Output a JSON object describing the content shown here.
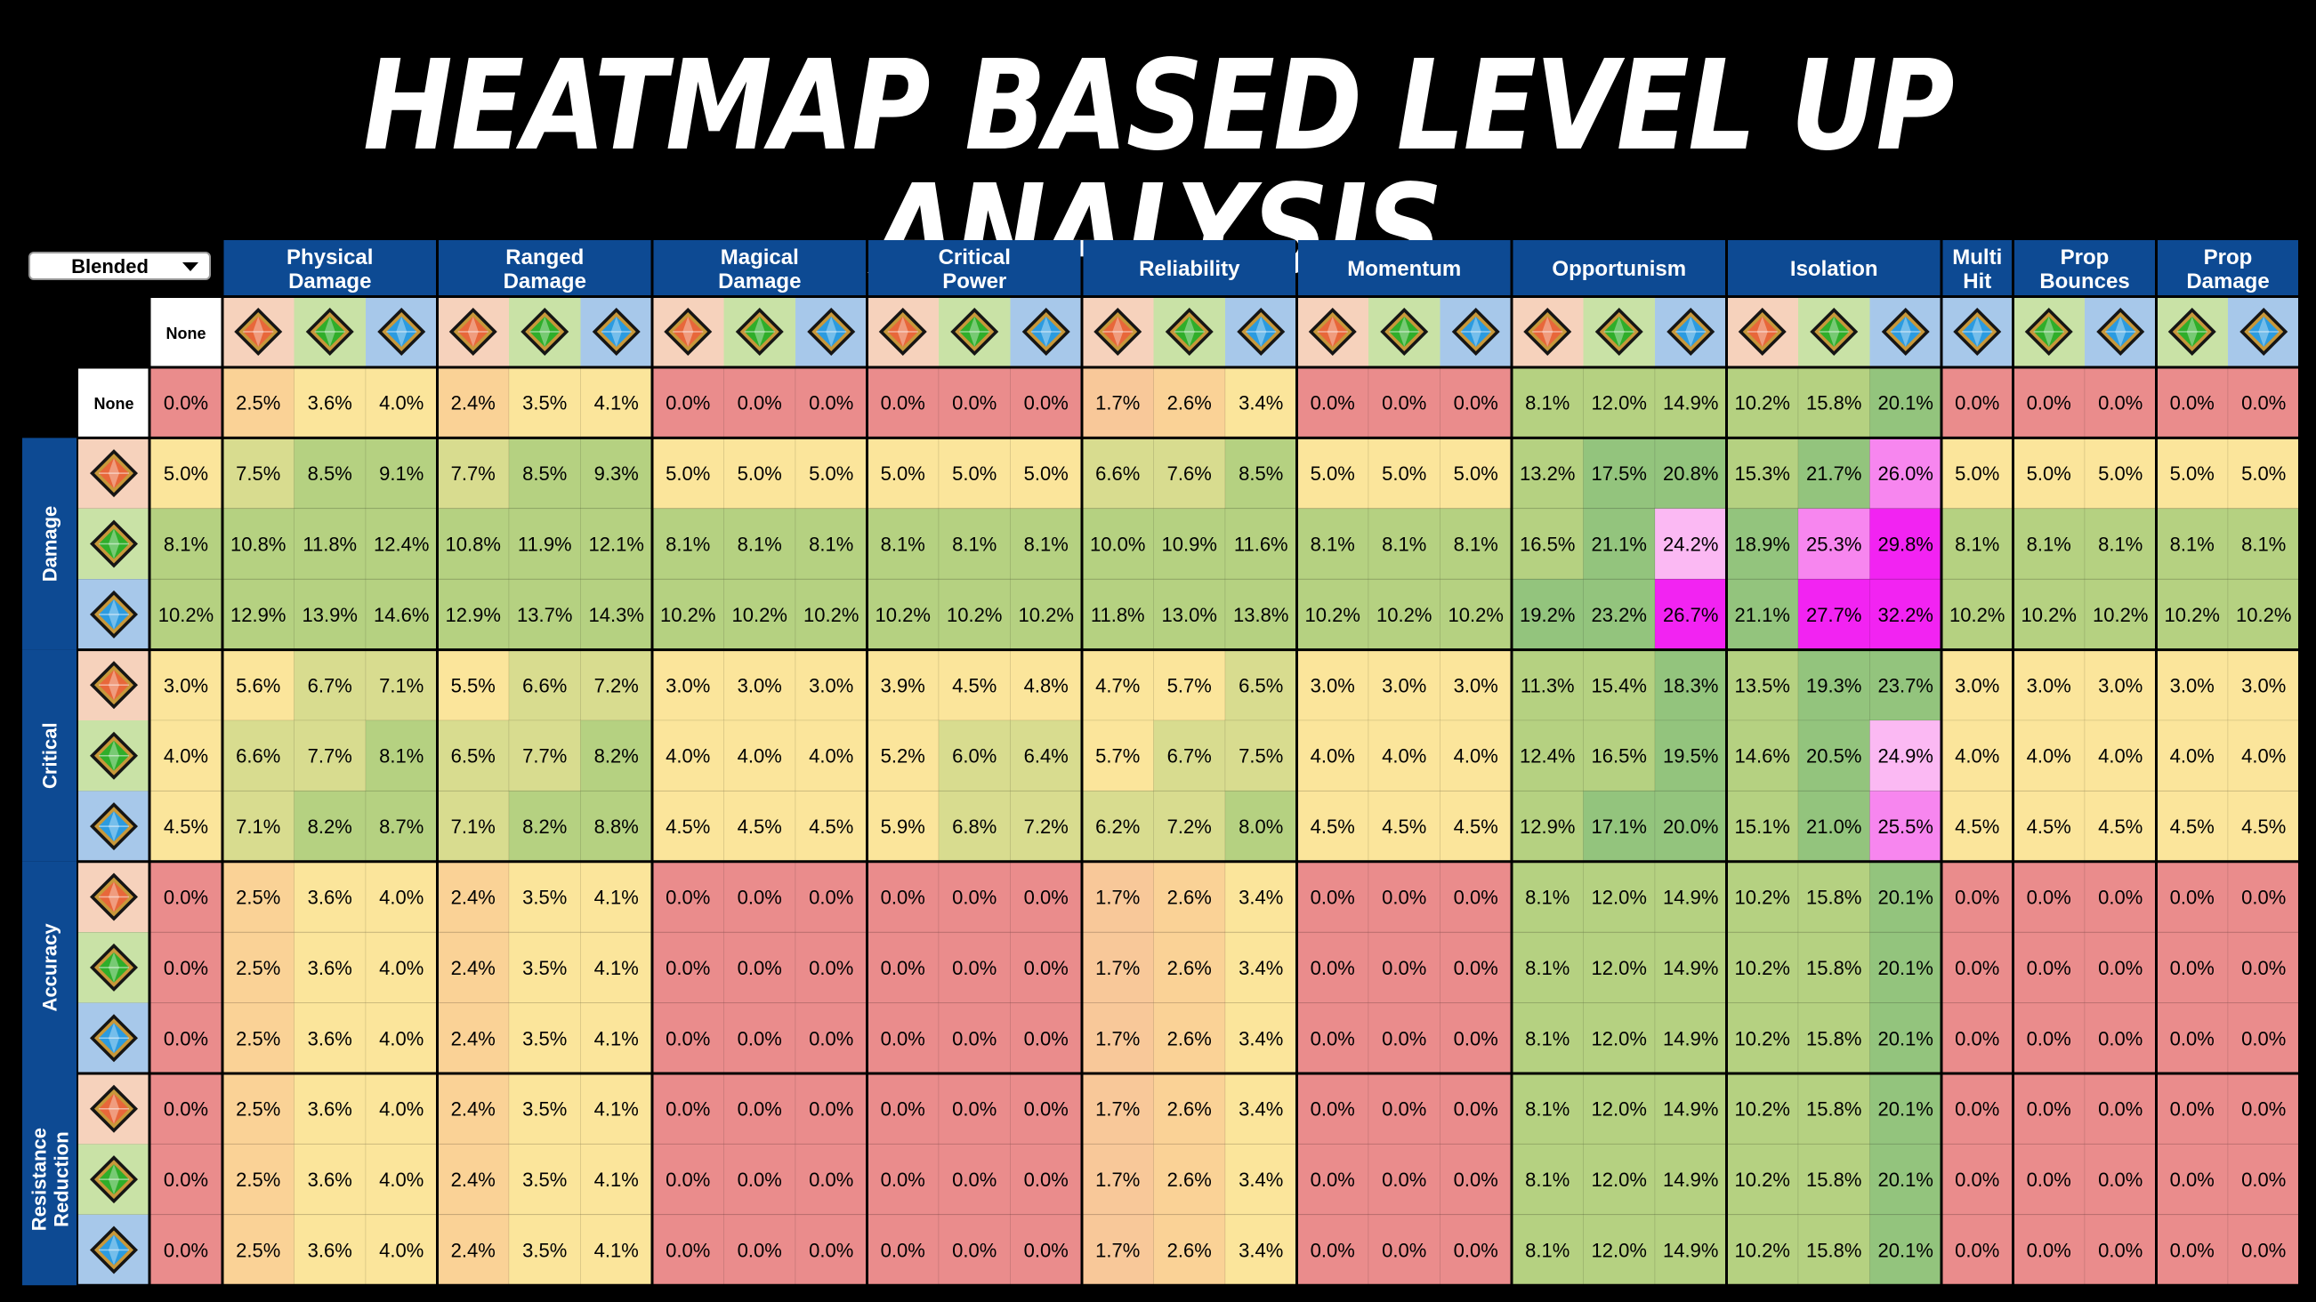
{
  "title": "HEATMAP BASED LEVEL UP ANALYSIS",
  "dropdown": {
    "selected": "Blended"
  },
  "colors": {
    "header_bg": "#0d4a93",
    "red": "#ea8c8c",
    "yellow": "#fbe59b",
    "orange": "#f8c899",
    "green": "#b5d181",
    "green_dark": "#93c47d",
    "pink_light": "#fbb9f3",
    "pink": "#f786ef",
    "magenta": "#f223f2",
    "gem_orange_bg": "#f6d2bc",
    "gem_green_bg": "#c9e2a6",
    "gem_blue_bg": "#a7c8ea"
  },
  "chart_data": {
    "type": "heatmap",
    "value_format": "percent",
    "column_groups": [
      {
        "label": "Physical\nDamage",
        "gems": [
          "orange",
          "green",
          "blue"
        ]
      },
      {
        "label": "Ranged\nDamage",
        "gems": [
          "orange",
          "green",
          "blue"
        ]
      },
      {
        "label": "Magical\nDamage",
        "gems": [
          "orange",
          "green",
          "blue"
        ]
      },
      {
        "label": "Critical\nPower",
        "gems": [
          "orange",
          "green",
          "blue"
        ]
      },
      {
        "label": "Reliability",
        "gems": [
          "orange",
          "green",
          "blue"
        ]
      },
      {
        "label": "Momentum",
        "gems": [
          "orange",
          "green",
          "blue"
        ]
      },
      {
        "label": "Opportunism",
        "gems": [
          "orange",
          "green",
          "blue"
        ]
      },
      {
        "label": "Isolation",
        "gems": [
          "orange",
          "green",
          "blue"
        ]
      },
      {
        "label": "Multi\nHit",
        "gems": [
          "blue"
        ]
      },
      {
        "label": "Prop\nBounces",
        "gems": [
          "green",
          "blue"
        ]
      },
      {
        "label": "Prop\nDamage",
        "gems": [
          "green",
          "blue"
        ]
      }
    ],
    "none_label": "None",
    "none_row_label": "None",
    "row_groups": [
      {
        "label": "",
        "rows": [
          {
            "gem": "none",
            "values": [
              0.0,
              2.5,
              3.6,
              4.0,
              2.4,
              3.5,
              4.1,
              0.0,
              0.0,
              0.0,
              0.0,
              0.0,
              0.0,
              1.7,
              2.6,
              3.4,
              0.0,
              0.0,
              0.0,
              8.1,
              12.0,
              14.9,
              10.2,
              15.8,
              20.1,
              0.0,
              0.0,
              0.0,
              0.0,
              0.0
            ]
          }
        ]
      },
      {
        "label": "Damage",
        "rows": [
          {
            "gem": "orange",
            "values": [
              5.0,
              7.5,
              8.5,
              9.1,
              7.7,
              8.5,
              9.3,
              5.0,
              5.0,
              5.0,
              5.0,
              5.0,
              5.0,
              6.6,
              7.6,
              8.5,
              5.0,
              5.0,
              5.0,
              13.2,
              17.5,
              20.8,
              15.3,
              21.7,
              26.0,
              5.0,
              5.0,
              5.0,
              5.0,
              5.0
            ]
          },
          {
            "gem": "green",
            "values": [
              8.1,
              10.8,
              11.8,
              12.4,
              10.8,
              11.9,
              12.1,
              8.1,
              8.1,
              8.1,
              8.1,
              8.1,
              8.1,
              10.0,
              10.9,
              11.6,
              8.1,
              8.1,
              8.1,
              16.5,
              21.1,
              24.2,
              18.9,
              25.3,
              29.8,
              8.1,
              8.1,
              8.1,
              8.1,
              8.1
            ]
          },
          {
            "gem": "blue",
            "values": [
              10.2,
              12.9,
              13.9,
              14.6,
              12.9,
              13.7,
              14.3,
              10.2,
              10.2,
              10.2,
              10.2,
              10.2,
              10.2,
              11.8,
              13.0,
              13.8,
              10.2,
              10.2,
              10.2,
              19.2,
              23.2,
              26.7,
              21.1,
              27.7,
              32.2,
              10.2,
              10.2,
              10.2,
              10.2,
              10.2
            ]
          }
        ]
      },
      {
        "label": "Critical",
        "rows": [
          {
            "gem": "orange",
            "values": [
              3.0,
              5.6,
              6.7,
              7.1,
              5.5,
              6.6,
              7.2,
              3.0,
              3.0,
              3.0,
              3.9,
              4.5,
              4.8,
              4.7,
              5.7,
              6.5,
              3.0,
              3.0,
              3.0,
              11.3,
              15.4,
              18.3,
              13.5,
              19.3,
              23.7,
              3.0,
              3.0,
              3.0,
              3.0,
              3.0
            ]
          },
          {
            "gem": "green",
            "values": [
              4.0,
              6.6,
              7.7,
              8.1,
              6.5,
              7.7,
              8.2,
              4.0,
              4.0,
              4.0,
              5.2,
              6.0,
              6.4,
              5.7,
              6.7,
              7.5,
              4.0,
              4.0,
              4.0,
              12.4,
              16.5,
              19.5,
              14.6,
              20.5,
              24.9,
              4.0,
              4.0,
              4.0,
              4.0,
              4.0
            ]
          },
          {
            "gem": "blue",
            "values": [
              4.5,
              7.1,
              8.2,
              8.7,
              7.1,
              8.2,
              8.8,
              4.5,
              4.5,
              4.5,
              5.9,
              6.8,
              7.2,
              6.2,
              7.2,
              8.0,
              4.5,
              4.5,
              4.5,
              12.9,
              17.1,
              20.0,
              15.1,
              21.0,
              25.5,
              4.5,
              4.5,
              4.5,
              4.5,
              4.5
            ]
          }
        ]
      },
      {
        "label": "Accuracy",
        "rows": [
          {
            "gem": "orange",
            "values": [
              0.0,
              2.5,
              3.6,
              4.0,
              2.4,
              3.5,
              4.1,
              0.0,
              0.0,
              0.0,
              0.0,
              0.0,
              0.0,
              1.7,
              2.6,
              3.4,
              0.0,
              0.0,
              0.0,
              8.1,
              12.0,
              14.9,
              10.2,
              15.8,
              20.1,
              0.0,
              0.0,
              0.0,
              0.0,
              0.0
            ]
          },
          {
            "gem": "green",
            "values": [
              0.0,
              2.5,
              3.6,
              4.0,
              2.4,
              3.5,
              4.1,
              0.0,
              0.0,
              0.0,
              0.0,
              0.0,
              0.0,
              1.7,
              2.6,
              3.4,
              0.0,
              0.0,
              0.0,
              8.1,
              12.0,
              14.9,
              10.2,
              15.8,
              20.1,
              0.0,
              0.0,
              0.0,
              0.0,
              0.0
            ]
          },
          {
            "gem": "blue",
            "values": [
              0.0,
              2.5,
              3.6,
              4.0,
              2.4,
              3.5,
              4.1,
              0.0,
              0.0,
              0.0,
              0.0,
              0.0,
              0.0,
              1.7,
              2.6,
              3.4,
              0.0,
              0.0,
              0.0,
              8.1,
              12.0,
              14.9,
              10.2,
              15.8,
              20.1,
              0.0,
              0.0,
              0.0,
              0.0,
              0.0
            ]
          }
        ]
      },
      {
        "label": "Resistance\nReduction",
        "rows": [
          {
            "gem": "orange",
            "values": [
              0.0,
              2.5,
              3.6,
              4.0,
              2.4,
              3.5,
              4.1,
              0.0,
              0.0,
              0.0,
              0.0,
              0.0,
              0.0,
              1.7,
              2.6,
              3.4,
              0.0,
              0.0,
              0.0,
              8.1,
              12.0,
              14.9,
              10.2,
              15.8,
              20.1,
              0.0,
              0.0,
              0.0,
              0.0,
              0.0
            ]
          },
          {
            "gem": "green",
            "values": [
              0.0,
              2.5,
              3.6,
              4.0,
              2.4,
              3.5,
              4.1,
              0.0,
              0.0,
              0.0,
              0.0,
              0.0,
              0.0,
              1.7,
              2.6,
              3.4,
              0.0,
              0.0,
              0.0,
              8.1,
              12.0,
              14.9,
              10.2,
              15.8,
              20.1,
              0.0,
              0.0,
              0.0,
              0.0,
              0.0
            ]
          },
          {
            "gem": "blue",
            "values": [
              0.0,
              2.5,
              3.6,
              4.0,
              2.4,
              3.5,
              4.1,
              0.0,
              0.0,
              0.0,
              0.0,
              0.0,
              0.0,
              1.7,
              2.6,
              3.4,
              0.0,
              0.0,
              0.0,
              8.1,
              12.0,
              14.9,
              10.2,
              15.8,
              20.1,
              0.0,
              0.0,
              0.0,
              0.0,
              0.0
            ]
          }
        ]
      }
    ]
  }
}
